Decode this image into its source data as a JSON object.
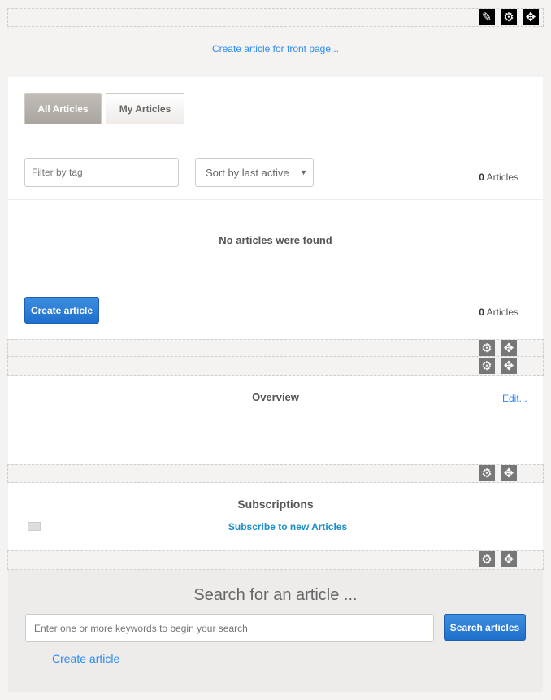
{
  "top_toolbar": {
    "icons": [
      "pencil-icon",
      "gear-icon",
      "move-icon"
    ]
  },
  "front_page_link": "Create article for front page...",
  "articles": {
    "tabs": [
      {
        "label": "All Articles",
        "active": true
      },
      {
        "label": "My Articles",
        "active": false
      }
    ],
    "filter_placeholder": "Filter by tag",
    "sort_value": "Sort by last active",
    "count_top": "0",
    "count_label": "Articles",
    "empty_message": "No articles were found",
    "create_button": "Create article",
    "count_bottom": "0"
  },
  "overview": {
    "title": "Overview",
    "edit_link": "Edit..."
  },
  "subscriptions": {
    "title": "Subscriptions",
    "subscribe_link": "Subscribe to new Articles"
  },
  "search": {
    "title": "Search for an article ...",
    "placeholder": "Enter one or more keywords to begin your search",
    "button": "Search articles",
    "create_link": "Create article"
  },
  "colors": {
    "link": "#2a8bf2",
    "button": "#1f6fcc",
    "subscribe_link": "#1a8fc9"
  }
}
